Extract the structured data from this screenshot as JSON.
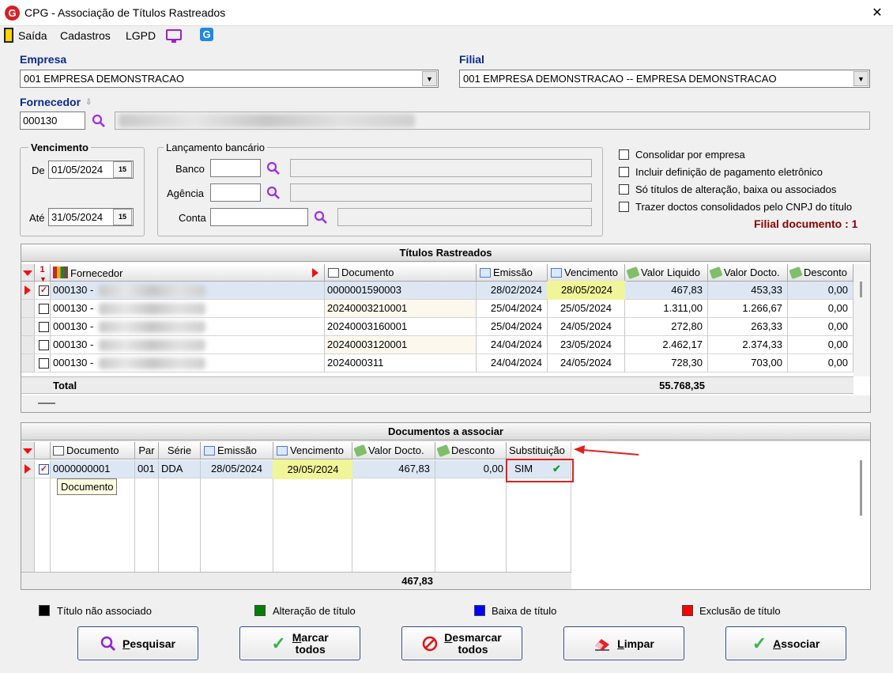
{
  "window": {
    "title": "CPG - Associação de Títulos Rastreados",
    "app_letter": "G"
  },
  "menu": {
    "items": [
      "Saída",
      "Cadastros",
      "LGPD"
    ]
  },
  "empresa": {
    "label": "Empresa",
    "value": "001 EMPRESA DEMONSTRACAO"
  },
  "filial": {
    "label": "Filial",
    "value": "001 EMPRESA DEMONSTRACAO -- EMPRESA DEMONSTRACAO"
  },
  "fornecedor": {
    "label": "Fornecedor",
    "code": "000130"
  },
  "vencimento": {
    "title": "Vencimento",
    "de_label": "De",
    "de_value": "01/05/2024",
    "ate_label": "Até",
    "ate_value": "31/05/2024",
    "cal_glyph": "15"
  },
  "lancamento": {
    "title": "Lançamento bancário",
    "banco_label": "Banco",
    "agencia_label": "Agência",
    "conta_label": "Conta"
  },
  "options": [
    {
      "label": "Consolidar por empresa",
      "checked": false
    },
    {
      "label": "Incluir definição de pagamento eletrônico",
      "checked": false
    },
    {
      "label": "Só títulos de alteração, baixa ou associados",
      "checked": false
    },
    {
      "label": "Trazer doctos consolidados pelo CNPJ do título",
      "checked": false
    }
  ],
  "filial_documento": "Filial documento : 1",
  "titulos": {
    "title": "Títulos Rastreados",
    "sort_indicator": "1",
    "headers": {
      "fornecedor": "Fornecedor",
      "documento": "Documento",
      "emissao": "Emissão",
      "vencimento": "Vencimento",
      "valor_liquido": "Valor Liquido",
      "valor_docto": "Valor Docto.",
      "desconto": "Desconto"
    },
    "rows": [
      {
        "fornecedor": "000130 -",
        "documento": "0000001590003",
        "emissao": "28/02/2024",
        "vencimento": "28/05/2024",
        "valor_liquido": "467,83",
        "valor_docto": "453,33",
        "desconto": "0,00",
        "checked": true
      },
      {
        "fornecedor": "000130 -",
        "documento": "20240003210001",
        "emissao": "25/04/2024",
        "vencimento": "25/05/2024",
        "valor_liquido": "1.311,00",
        "valor_docto": "1.266,67",
        "desconto": "0,00",
        "checked": false
      },
      {
        "fornecedor": "000130 -",
        "documento": "20240003160001",
        "emissao": "25/04/2024",
        "vencimento": "24/05/2024",
        "valor_liquido": "272,80",
        "valor_docto": "263,33",
        "desconto": "0,00",
        "checked": false
      },
      {
        "fornecedor": "000130 -",
        "documento": "20240003120001",
        "emissao": "24/04/2024",
        "vencimento": "23/05/2024",
        "valor_liquido": "2.462,17",
        "valor_docto": "2.374,33",
        "desconto": "0,00",
        "checked": false
      },
      {
        "fornecedor": "000130 -",
        "documento": "2024000311",
        "emissao": "24/04/2024",
        "vencimento": "24/05/2024",
        "valor_liquido": "728,30",
        "valor_docto": "703,00",
        "desconto": "0,00",
        "checked": false
      }
    ],
    "total_label": "Total",
    "total_value": "55.768,35"
  },
  "documentos": {
    "title": "Documentos a associar",
    "headers": {
      "documento": "Documento",
      "par": "Par",
      "serie": "Série",
      "emissao": "Emissão",
      "vencimento": "Vencimento",
      "valor_docto": "Valor Docto.",
      "desconto": "Desconto",
      "substituicao": "Substituição"
    },
    "rows": [
      {
        "documento": "0000000001",
        "par": "001",
        "serie": "DDA",
        "emissao": "28/05/2024",
        "vencimento": "29/05/2024",
        "valor_docto": "467,83",
        "desconto": "0,00",
        "substituicao": "SIM",
        "checked": true
      }
    ],
    "total_value": "467,83",
    "tooltip": "Documento"
  },
  "legend": [
    {
      "label": "Título não associado",
      "color": "#000000"
    },
    {
      "label": "Alteração de título",
      "color": "#008000"
    },
    {
      "label": "Baixa de título",
      "color": "#0000ff"
    },
    {
      "label": "Exclusão de título",
      "color": "#ff0000"
    }
  ],
  "buttons": {
    "pesquisar": {
      "hot": "P",
      "rest": "esquisar"
    },
    "marcar": {
      "hot": "M",
      "rest": "arcar",
      "line2": "todos"
    },
    "desmarcar": {
      "hot": "D",
      "rest": "esmarcar",
      "line2": "todos"
    },
    "limpar": {
      "hot": "L",
      "rest": "impar"
    },
    "associar": {
      "hot": "A",
      "rest": "ssociar"
    }
  },
  "colors": {
    "accent_blue": "#0b2a8f",
    "highlight_yellow": "#f1f59a",
    "red": "#e11111",
    "green_check": "#1a9a3a"
  }
}
